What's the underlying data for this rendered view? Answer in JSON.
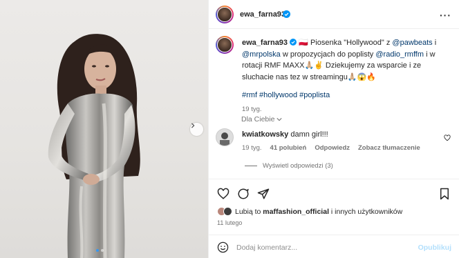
{
  "post": {
    "username": "ewa_farna93",
    "caption_flag": "🇵🇱",
    "caption_pre": "Piosenka \"Hollywood\" z ",
    "mention1": "@pawbeats",
    "caption_mid1": " i ",
    "mention2": "@mrpolska",
    "caption_mid2": " w propozycjach do poplisty ",
    "mention3": "@radio_rmffm",
    "caption_post": " i w rotacji RMF MAXX🙏🏼✌️ Dziekujemy za wsparcie i ze sluchacie nas tez w streamingu🙏🏼😱🔥",
    "hashtags": "#rmf #hollywood #poplista",
    "age": "19 tyg."
  },
  "sort": {
    "label": "Dla Ciebie"
  },
  "comment": {
    "username": "kwiatkowsky",
    "text": "damn girl!!!",
    "age": "19 tyg.",
    "likes": "41 polubień",
    "reply": "Odpowiedz",
    "translate": "Zobacz tłumaczenie",
    "view_replies": "Wyświetl odpowiedzi (3)"
  },
  "likes": {
    "prefix": "Lubią to ",
    "user": "maffashion_official",
    "suffix": " i innych użytkowników"
  },
  "date": "11 lutego",
  "composer": {
    "placeholder": "Dodaj komentarz...",
    "post_label": "Opublikuj"
  },
  "colors": {
    "accent": "#3797f0",
    "link": "#00376b",
    "verified": "#0095f6"
  },
  "icons": [
    "heart-icon",
    "comment-icon",
    "share-icon",
    "bookmark-icon",
    "emoji-icon",
    "more-icon",
    "chevron-right-icon",
    "chevron-down-icon",
    "verified-icon"
  ]
}
